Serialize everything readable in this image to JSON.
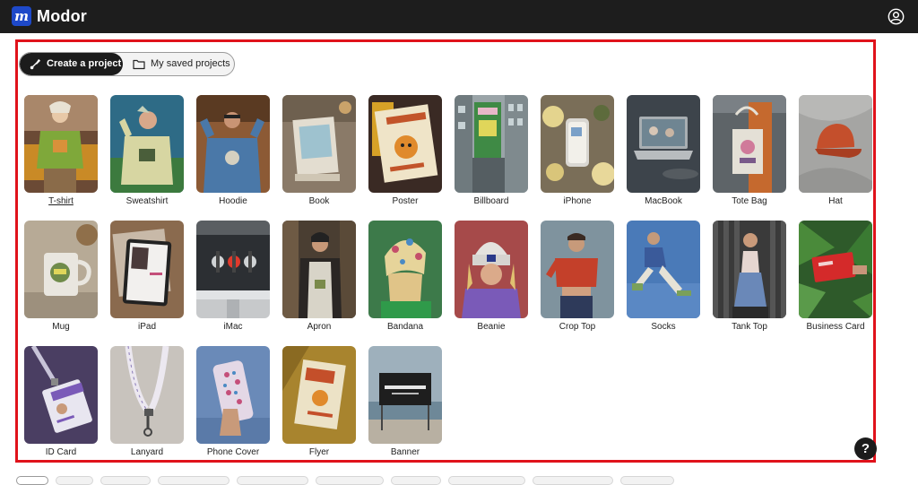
{
  "app": {
    "name": "Modor",
    "logo_letter": "m"
  },
  "tabs": [
    {
      "label": "Create a project",
      "active": true
    },
    {
      "label": "My saved projects",
      "active": false
    }
  ],
  "templates": [
    {
      "label": "T-shirt",
      "icon": "tshirt-mockup-image",
      "active": true
    },
    {
      "label": "Sweatshirt",
      "icon": "sweatshirt-mockup-image"
    },
    {
      "label": "Hoodie",
      "icon": "hoodie-mockup-image"
    },
    {
      "label": "Book",
      "icon": "book-mockup-image"
    },
    {
      "label": "Poster",
      "icon": "poster-mockup-image"
    },
    {
      "label": "Billboard",
      "icon": "billboard-mockup-image"
    },
    {
      "label": "iPhone",
      "icon": "iphone-mockup-image"
    },
    {
      "label": "MacBook",
      "icon": "macbook-mockup-image"
    },
    {
      "label": "Tote Bag",
      "icon": "tote-bag-mockup-image"
    },
    {
      "label": "Hat",
      "icon": "hat-mockup-image"
    },
    {
      "label": "Mug",
      "icon": "mug-mockup-image"
    },
    {
      "label": "iPad",
      "icon": "ipad-mockup-image"
    },
    {
      "label": "iMac",
      "icon": "imac-mockup-image"
    },
    {
      "label": "Apron",
      "icon": "apron-mockup-image"
    },
    {
      "label": "Bandana",
      "icon": "bandana-mockup-image"
    },
    {
      "label": "Beanie",
      "icon": "beanie-mockup-image"
    },
    {
      "label": "Crop Top",
      "icon": "crop-top-mockup-image"
    },
    {
      "label": "Socks",
      "icon": "socks-mockup-image"
    },
    {
      "label": "Tank Top",
      "icon": "tank-top-mockup-image"
    },
    {
      "label": "Business Card",
      "icon": "business-card-mockup-image"
    },
    {
      "label": "ID Card",
      "icon": "id-card-mockup-image"
    },
    {
      "label": "Lanyard",
      "icon": "lanyard-mockup-image"
    },
    {
      "label": "Phone Cover",
      "icon": "phone-cover-mockup-image"
    },
    {
      "label": "Flyer",
      "icon": "flyer-mockup-image"
    },
    {
      "label": "Banner",
      "icon": "banner-mockup-image"
    }
  ],
  "help": {
    "label": "?"
  },
  "colors": {
    "topbar": "#1d1d1d",
    "brand": "#1e49c9",
    "highlight_frame": "#e0121b"
  }
}
